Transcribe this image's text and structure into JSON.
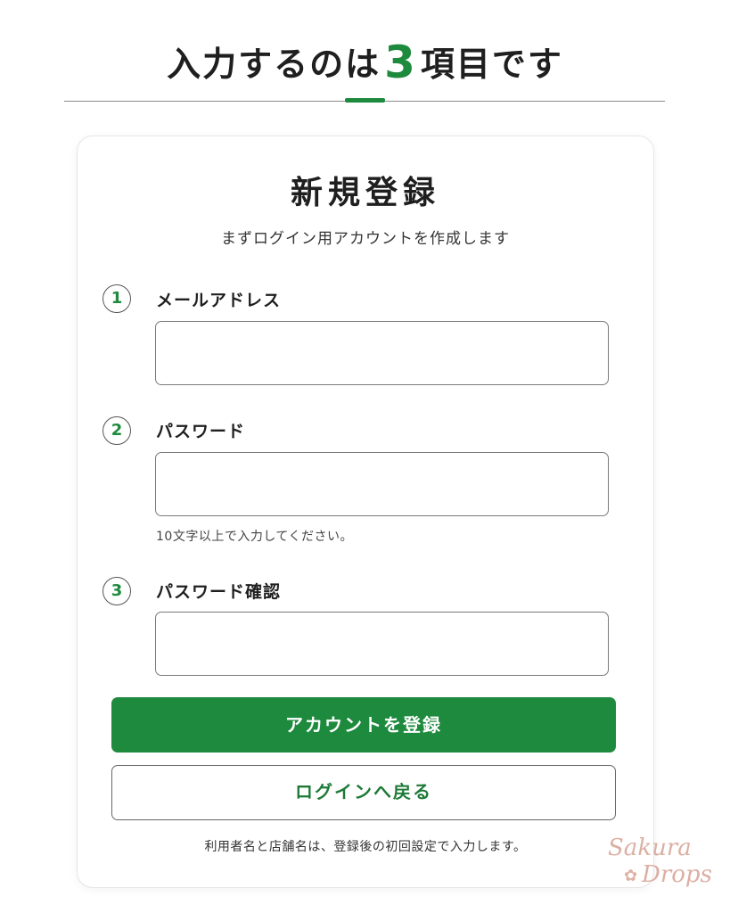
{
  "header": {
    "title_before": "入力するのは",
    "title_number": "3",
    "title_after": "項目です"
  },
  "form": {
    "title": "新規登録",
    "subtitle": "まずログイン用アカウントを作成します",
    "fields": [
      {
        "number": "1",
        "label": "メールアドレス",
        "value": "",
        "hint": ""
      },
      {
        "number": "2",
        "label": "パスワード",
        "value": "",
        "hint": "10文字以上で入力してください。"
      },
      {
        "number": "3",
        "label": "パスワード確認",
        "value": "",
        "hint": ""
      }
    ],
    "submit_label": "アカウントを登録",
    "back_label": "ログインへ戻る",
    "footnote": "利用者名と店舗名は、登録後の初回設定で入力します。"
  },
  "watermark": {
    "line1": "Sakura",
    "line2": "Drops"
  },
  "colors": {
    "accent_green": "#1e8a3e",
    "watermark_pink": "#d9a79a"
  },
  "icons": {
    "watermark_flower": "flower-icon"
  }
}
